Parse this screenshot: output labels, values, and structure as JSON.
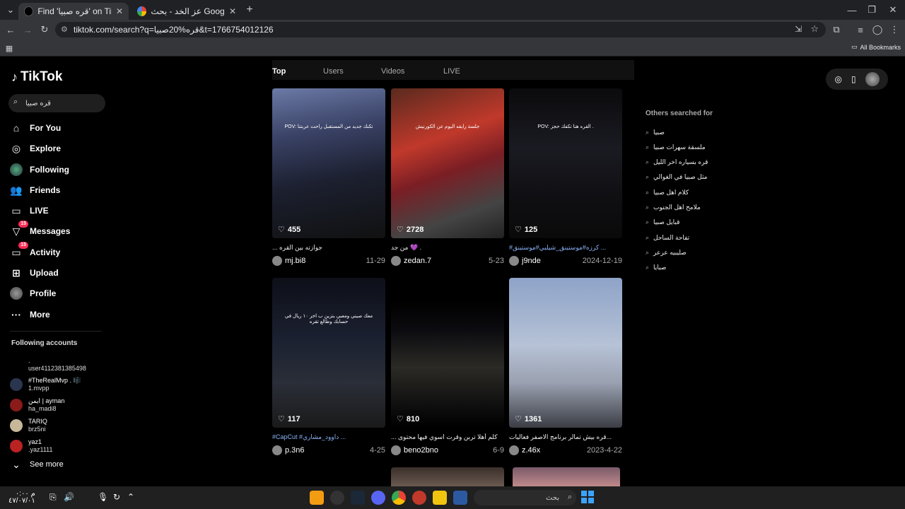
{
  "browser": {
    "tabs": [
      {
        "title": "Find 'قره صبيا' on TikTok | TikTok"
      },
      {
        "title": "عز الخد - بحث Google"
      }
    ],
    "url": "tiktok.com/search?q=قره%20صبيا&t=1766754012126",
    "bookmarks_label": "All Bookmarks"
  },
  "sidebar": {
    "logo": "TikTok",
    "search_value": "قره صبيا",
    "nav": [
      {
        "label": "For You",
        "icon": "home-icon"
      },
      {
        "label": "Explore",
        "icon": "compass-icon"
      },
      {
        "label": "Following",
        "icon": "following-icon"
      },
      {
        "label": "Friends",
        "icon": "friends-icon"
      },
      {
        "label": "LIVE",
        "icon": "live-icon"
      },
      {
        "label": "Messages",
        "icon": "messages-icon",
        "badge": "15"
      },
      {
        "label": "Activity",
        "icon": "activity-icon",
        "badge": "15"
      },
      {
        "label": "Upload",
        "icon": "upload-icon"
      },
      {
        "label": "Profile",
        "icon": "avatar"
      },
      {
        "label": "More",
        "icon": "more-icon"
      }
    ],
    "following_heading": "Following accounts",
    "accounts": [
      {
        "name": ".",
        "handle": "user4112381385498",
        "color": "#000"
      },
      {
        "name": "#TheRealMvp . 🎼",
        "handle": "1.mvpp",
        "color": "#2a3550"
      },
      {
        "name": "ايمن | ayman",
        "handle": "ha_madi8",
        "color": "#8b1a1a"
      },
      {
        "name": "TARIQ",
        "handle": "brz5ni",
        "color": "#c8b89a"
      },
      {
        "name": "yaz1",
        "handle": ".yaz1111",
        "color": "#b22"
      }
    ],
    "see_more": "See more"
  },
  "search_tabs": [
    "Top",
    "Users",
    "Videos",
    "LIVE"
  ],
  "videos": [
    {
      "likes": "455",
      "caption": "... جوازته بين القره",
      "user": "mj.bi8",
      "date": "11-29",
      "caption_blue": false,
      "bg": "linear-gradient(170deg,#6b7aa6 0%,#3a4266 30%,#1c2030 60%,#111 100%)",
      "overlay": "POV: تكنك جديد من المستقبل راحت عربتنا"
    },
    {
      "likes": "2728",
      "caption": "من جد 💜 .",
      "user": "zedan.7",
      "date": "5-23",
      "caption_blue": false,
      "bg": "linear-gradient(160deg,#5a2a1e 0%,#c0392b 35%,#7b1e24 55%,#444 80%,#222 100%)",
      "overlay": "جلسة رايقه اليوم عن الكورنيش"
    },
    {
      "likes": "125",
      "caption": "#كرزه#موستينق_شيلبي#موستينق ...",
      "user": "j9nde",
      "date": "2024-12-19",
      "caption_blue": true,
      "bg": "linear-gradient(180deg,#0b0b0d 0%,#1a1a22 40%,#101014 70%,#0a0a0a 100%)",
      "overlay": "POV: القره هنا تكفك حجز ."
    },
    {
      "likes": "117",
      "caption": "#CapCut #داوود_مشاري ...",
      "user": "p.3n6",
      "date": "4-25",
      "caption_blue": true,
      "bg": "linear-gradient(180deg,#0d0f18 0%,#1b2030 40%,#2a2e38 70%,#1a1a1a 100%)",
      "overlay": "معك صيني ومعبي بنزين ب اخر ١٠ ريال في حسابك وطالع تقره"
    },
    {
      "likes": "810",
      "caption": "... كلم أهلا تربن وقرت اسوي فيها محتوى",
      "user": "beno2bno",
      "date": "6-9",
      "caption_blue": false,
      "bg": "linear-gradient(180deg,#000 0%,#000 15%,#0c0c10 35%,#2b2a25 60%,#0f0f0f 85%,#000 100%)",
      "overlay": ""
    },
    {
      "likes": "1361",
      "caption": "قره بيش تمالر برنامج الاصفر فعاليات...",
      "user": "z.46x",
      "date": "2023-4-22",
      "caption_blue": false,
      "bg": "linear-gradient(180deg,#8ea3c8 0%,#b6c2d6 45%,#9aa1b0 70%,#3b3d45 100%)",
      "overlay": ""
    }
  ],
  "others_heading": "Others searched for",
  "suggestions": [
    "صبيا",
    "ملسقة سهرات صبيا",
    "قره بسياره اخر الليل",
    "مثل صبيا في الغوالي",
    "كلام اهل صبيا",
    "ملامح اهل الجنوب",
    "قبايل صبيا",
    "تفاحة الساحل",
    "صليبيه عرعر",
    "صبايا"
  ],
  "taskbar": {
    "search_placeholder": "بحث",
    "clock": "م ٠:٠٠",
    "date": "٤٧/٠٧/٠١"
  }
}
